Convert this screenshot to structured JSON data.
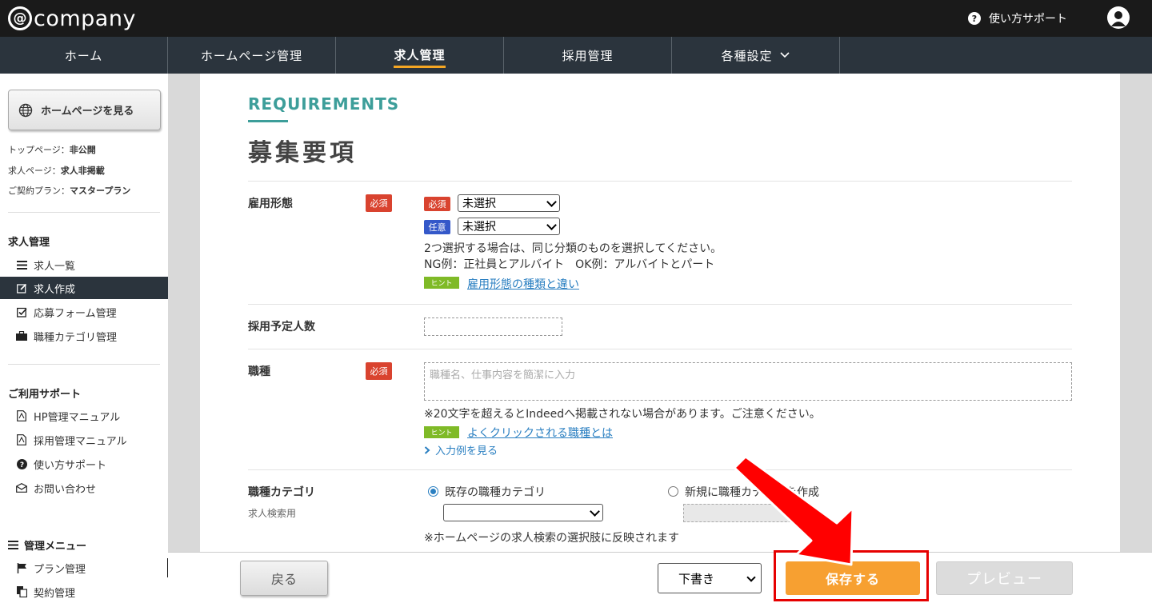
{
  "header": {
    "logo_text": "company",
    "logo_at": "@",
    "support_label": "使い方サポート"
  },
  "nav": {
    "tabs": [
      {
        "label": "ホーム"
      },
      {
        "label": "ホームページ管理"
      },
      {
        "label": "求人管理",
        "active": true
      },
      {
        "label": "採用管理"
      },
      {
        "label": "各種設定"
      }
    ]
  },
  "sidebar": {
    "view_hp_label": "ホームページを見る",
    "status": [
      {
        "key": "トップページ：",
        "value": "非公開"
      },
      {
        "key": "求人ページ：",
        "value": "求人非掲載"
      },
      {
        "key": "ご契約プラン：",
        "value": "マスタープラン"
      }
    ],
    "section1_title": "求人管理",
    "section1_items": [
      {
        "label": "求人一覧",
        "icon": "list-icon"
      },
      {
        "label": "求人作成",
        "icon": "edit-icon",
        "active": true
      },
      {
        "label": "応募フォーム管理",
        "icon": "checkbox-icon"
      },
      {
        "label": "職種カテゴリ管理",
        "icon": "briefcase-icon"
      }
    ],
    "section2_title": "ご利用サポート",
    "section2_items": [
      {
        "label": "HP管理マニュアル",
        "icon": "pdf-icon"
      },
      {
        "label": "採用管理マニュアル",
        "icon": "pdf-icon"
      },
      {
        "label": "使い方サポート",
        "icon": "question-icon"
      },
      {
        "label": "お問い合わせ",
        "icon": "mail-icon"
      }
    ],
    "section3_title": "管理メニュー",
    "section3_items": [
      {
        "label": "プラン管理",
        "icon": "flag-icon"
      },
      {
        "label": "契約管理",
        "icon": "copy-icon"
      }
    ]
  },
  "main": {
    "heading_en": "REQUIREMENTS",
    "heading_jp": "募集要項",
    "employment": {
      "label": "雇用形態",
      "required_badge": "必須",
      "mini_required": "必須",
      "mini_optional": "任意",
      "select1_value": "未選択",
      "select2_value": "未選択",
      "note1": "2つ選択する場合は、同じ分類のものを選択してください。",
      "note2": "NG例：正社員とアルバイト　OK例：アルバイトとパート",
      "hint_badge": "ヒント",
      "hint_link": "雇用形態の種類と違い"
    },
    "headcount": {
      "label": "採用予定人数"
    },
    "job_type": {
      "label": "職種",
      "required_badge": "必須",
      "placeholder": "職種名、仕事内容を簡潔に入力",
      "note": "※20文字を超えるとIndeedへ掲載されない場合があります。ご注意ください。",
      "hint_badge": "ヒント",
      "hint_link": "よくクリックされる職種とは",
      "more_link": "入力例を見る"
    },
    "category": {
      "label": "職種カテゴリ",
      "sub": "求人検索用",
      "radio1": "既存の職種カテゴリ",
      "radio2": "新規に職種カテゴリを作成",
      "note": "※ホームページの求人検索の選択肢に反映されます"
    }
  },
  "footer": {
    "back_label": "戻る",
    "draft_value": "下書き",
    "save_label": "保存する",
    "preview_label": "プレビュー"
  },
  "colors": {
    "accent_orange": "#f7a031",
    "teal": "#3d9e9a",
    "required_red": "#d9432f",
    "highlight_red": "#e60000"
  }
}
